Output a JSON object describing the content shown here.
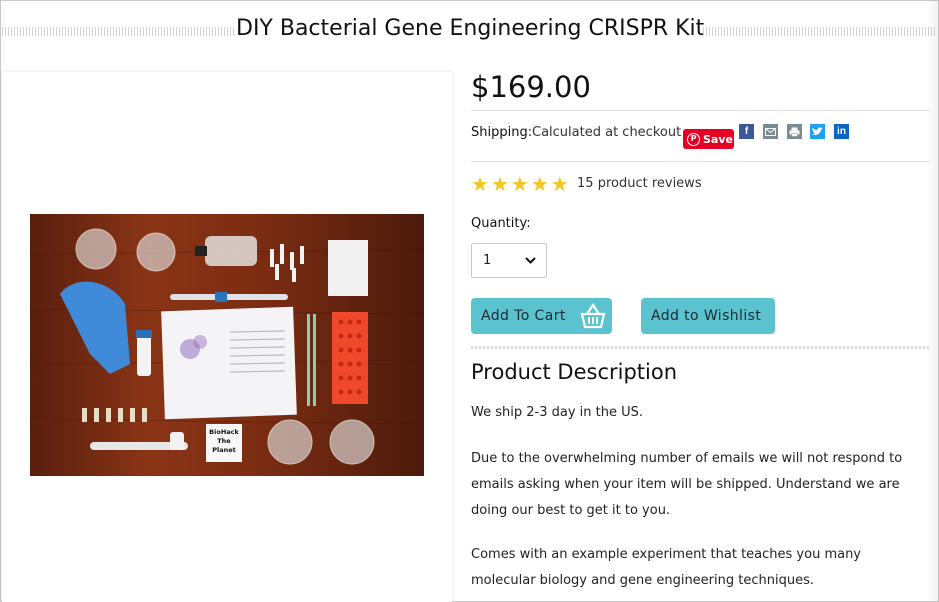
{
  "product": {
    "title": "DIY Bacterial Gene Engineering CRISPR Kit",
    "price": "$169.00",
    "shipping_label": "Shipping:",
    "shipping_value": "Calculated at checkout",
    "rating_stars": 5,
    "reviews_count": "15",
    "reviews_text": "product reviews",
    "quantity_label": "Quantity:",
    "quantity_value": "1",
    "add_to_cart_label": "Add To Cart",
    "add_to_wishlist_label": "Add to Wishlist",
    "photo_note_text": "BioHack The Planet"
  },
  "share": {
    "pinterest_label": "Save",
    "icons": [
      "facebook-icon",
      "email-icon",
      "print-icon",
      "twitter-icon",
      "linkedin-icon"
    ]
  },
  "description": {
    "heading": "Product Description",
    "paragraphs": [
      "We ship 2-3 day in the US.",
      "Due to the overwhelming number of emails we will not respond to emails asking when your item will be shipped. Understand we are doing our best to get it to you.",
      "Comes with an example experiment that teaches you many molecular biology and gene engineering techniques."
    ]
  },
  "colors": {
    "accent": "#5bc3cf",
    "star": "#f2c623",
    "pinterest": "#e60023",
    "facebook": "#3b5998",
    "twitter": "#1da1f2",
    "linkedin": "#0a66c2"
  }
}
